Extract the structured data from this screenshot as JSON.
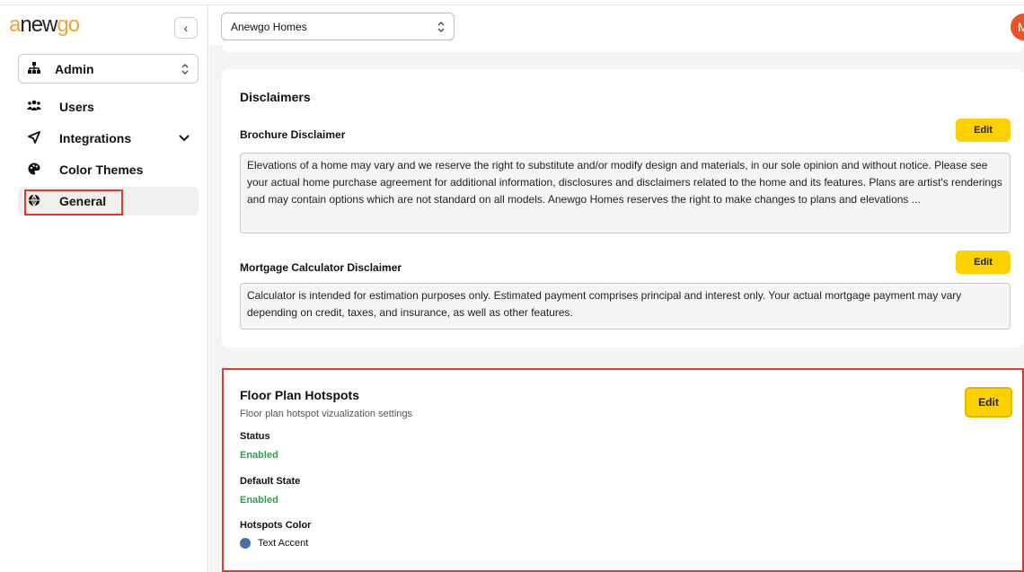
{
  "logo": {
    "part1": "a",
    "part2": "new",
    "part3": "go"
  },
  "sidebar": {
    "collapse_glyph": "‹",
    "role": {
      "label": "Admin",
      "icon": "sitemap-icon"
    },
    "items": [
      {
        "label": "Users",
        "icon": "users-icon"
      },
      {
        "label": "Integrations",
        "icon": "send-icon",
        "expandable": true
      },
      {
        "label": "Color Themes",
        "icon": "palette-icon"
      },
      {
        "label": "General",
        "icon": "globe-icon",
        "active": true
      }
    ]
  },
  "header": {
    "company": "Anewgo Homes",
    "avatar_initial": "M"
  },
  "disclaimers": {
    "title": "Disclaimers",
    "brochure": {
      "label": "Brochure Disclaimer",
      "edit": "Edit",
      "text": "Elevations of a home may vary and we reserve the right to substitute and/or modify design and materials, in our sole opinion and without notice. Please see your actual home purchase agreement for additional information, disclosures and disclaimers related to the home and its features. Plans are artist's renderings and may contain options which are not standard on all models. Anewgo Homes reserves the right to make changes to plans and elevations ..."
    },
    "mortgage": {
      "label": "Mortgage Calculator Disclaimer",
      "edit": "Edit",
      "text": "Calculator is intended for estimation purposes only. Estimated payment comprises principal and interest only. Your actual mortgage payment may vary depending on credit, taxes, and insurance, as well as other features."
    }
  },
  "hotspots": {
    "title": "Floor Plan Hotspots",
    "description": "Floor plan hotspot vizualization settings",
    "edit": "Edit",
    "status_label": "Status",
    "status_value": "Enabled",
    "default_state_label": "Default State",
    "default_state_value": "Enabled",
    "color_label": "Hotspots Color",
    "color_value": "Text Accent",
    "color_hex": "#4a6ea8"
  },
  "colors": {
    "accent_yellow": "#fdd000",
    "highlight_red": "#e23a2a",
    "enabled_green": "#2e9e4f",
    "avatar": "#e8542a"
  }
}
